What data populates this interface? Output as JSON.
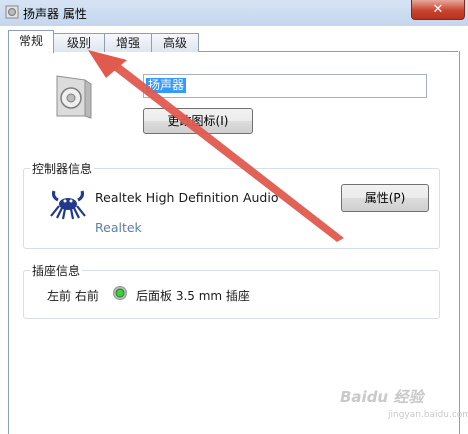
{
  "window": {
    "title": "扬声器 属性",
    "close_glyph": "✕"
  },
  "tabs": [
    {
      "label": "常规",
      "active": true
    },
    {
      "label": "级别",
      "active": false
    },
    {
      "label": "增强",
      "active": false
    },
    {
      "label": "高级",
      "active": false
    }
  ],
  "device": {
    "name_value": "扬声器",
    "change_icon_label": "更改图标(I)"
  },
  "controller": {
    "group_title": "控制器信息",
    "name": "Realtek High Definition Audio",
    "vendor": "Realtek",
    "properties_label": "属性(P)"
  },
  "jack": {
    "group_title": "插座信息",
    "left_label": "左前 右前",
    "right_label": "后面板 3.5 mm 插座"
  },
  "watermark": {
    "text": "Baidu 经验",
    "sub": "jingyan.baidu.com"
  },
  "colors": {
    "arrow": "#e05a4e",
    "jack_green": "#2fb52f",
    "accent": "#3399ff"
  }
}
